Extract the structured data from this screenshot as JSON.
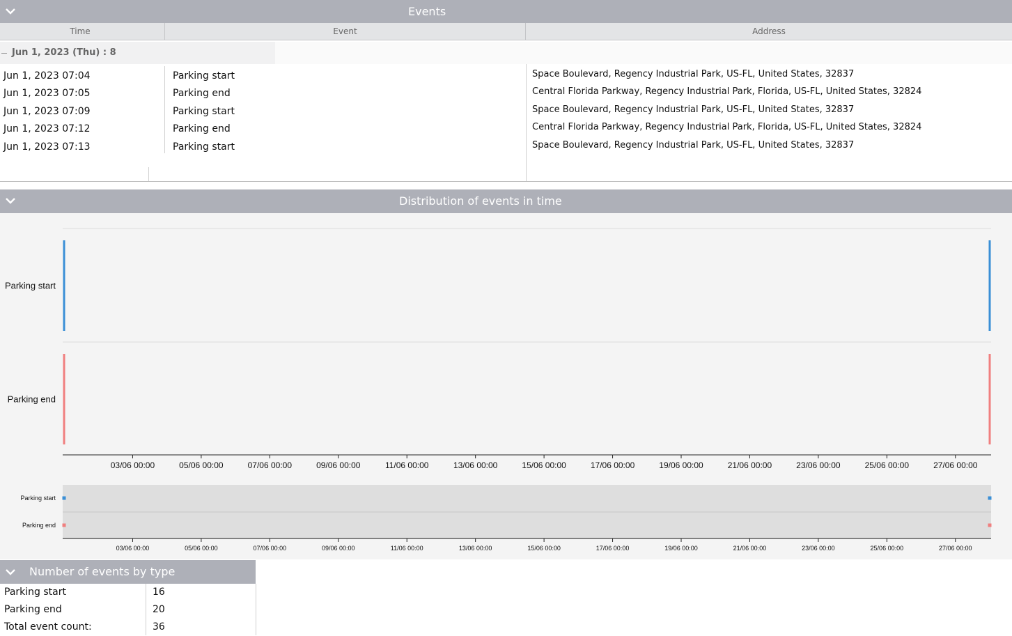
{
  "events_panel": {
    "title": "Events",
    "columns": [
      "Time",
      "Event",
      "Address"
    ],
    "group_label": "Jun 1, 2023 (Thu) : 8",
    "rows": [
      {
        "time": "Jun 1, 2023 07:04",
        "event": "Parking start",
        "address": "Space Boulevard, Regency Industrial Park, US-FL, United States, 32837"
      },
      {
        "time": "Jun 1, 2023 07:05",
        "event": "Parking end",
        "address": "Central Florida Parkway, Regency Industrial Park, Florida, US-FL, United States, 32824"
      },
      {
        "time": "Jun 1, 2023 07:09",
        "event": "Parking start",
        "address": "Space Boulevard, Regency Industrial Park, US-FL, United States, 32837"
      },
      {
        "time": "Jun 1, 2023 07:12",
        "event": "Parking end",
        "address": "Central Florida Parkway, Regency Industrial Park, Florida, US-FL, United States, 32824"
      },
      {
        "time": "Jun 1, 2023 07:13",
        "event": "Parking start",
        "address": "Space Boulevard, Regency Industrial Park, US-FL, United States, 32837"
      }
    ]
  },
  "distribution_panel": {
    "title": "Distribution of events in time"
  },
  "chart_data": {
    "type": "timeline",
    "x_axis": "date",
    "tick_labels": [
      "03/06 00:00",
      "05/06 00:00",
      "07/06 00:00",
      "09/06 00:00",
      "11/06 00:00",
      "13/06 00:00",
      "15/06 00:00",
      "17/06 00:00",
      "19/06 00:00",
      "21/06 00:00",
      "23/06 00:00",
      "25/06 00:00",
      "27/06 00:00"
    ],
    "x_range": [
      "2023-06-01",
      "2023-06-28"
    ],
    "series": [
      {
        "name": "Parking start",
        "color": "#3a8fd6",
        "x": [
          "2023-06-01",
          "2023-06-28"
        ]
      },
      {
        "name": "Parking end",
        "color": "#f07f7f",
        "x": [
          "2023-06-01",
          "2023-06-28"
        ]
      }
    ]
  },
  "counts_panel": {
    "title": "Number of events by type",
    "rows": [
      {
        "label": "Parking start",
        "value": "16"
      },
      {
        "label": "Parking end",
        "value": "20"
      },
      {
        "label": "Total event count:",
        "value": "36"
      }
    ]
  },
  "colors": {
    "header_bg": "#aeb0b8",
    "parking_start": "#3a8fd6",
    "parking_end": "#f07f7f"
  },
  "icons": {
    "collapse": "chevron-down-icon"
  }
}
